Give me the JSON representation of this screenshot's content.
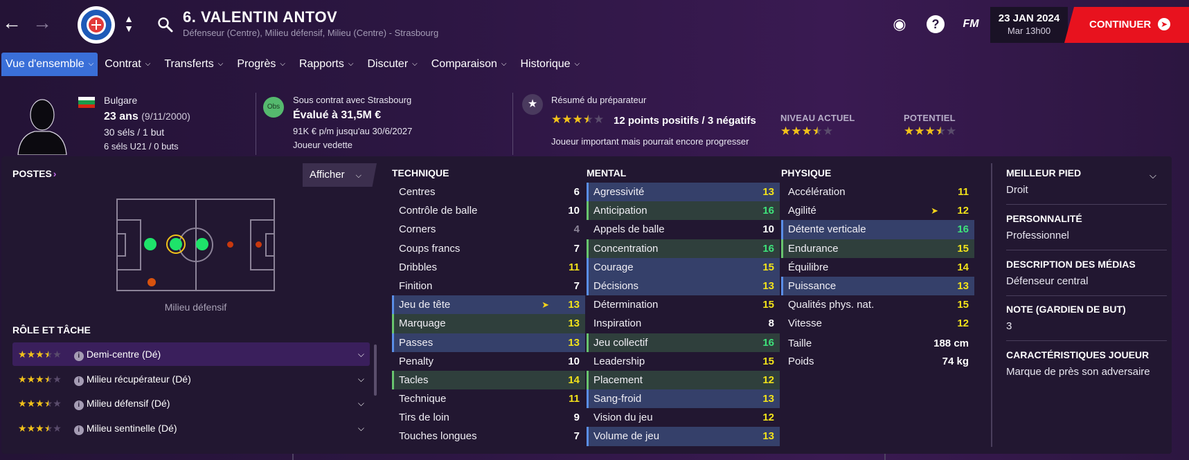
{
  "header": {
    "player_title": "6. VALENTIN ANTOV",
    "player_subtitle": "Défenseur (Centre), Milieu défensif, Milieu (Centre) - Strasbourg",
    "date": "23 JAN 2024",
    "time": "Mar 13h00",
    "continue_label": "CONTINUER",
    "fm_label": "FM",
    "help_label": "?"
  },
  "tabs": [
    {
      "label": "Vue d'ensemble"
    },
    {
      "label": "Contrat"
    },
    {
      "label": "Transferts"
    },
    {
      "label": "Progrès"
    },
    {
      "label": "Rapports"
    },
    {
      "label": "Discuter"
    },
    {
      "label": "Comparaison"
    },
    {
      "label": "Historique"
    }
  ],
  "profile": {
    "nationality": "Bulgare",
    "age": "23 ans",
    "birthdate": "(9/11/2000)",
    "caps": "30 séls / 1 but",
    "u21_caps": "6 séls U21 / 0 buts",
    "contract_status": "Sous contrat avec Strasbourg",
    "value": "Évalué à 31,5M €",
    "wage": "91K € p/m jusqu'au 30/6/2027",
    "squad_status": "Joueur vedette",
    "obs_label": "Obs",
    "coach_summary_title": "Résumé du préparateur",
    "coach_summary_points": "12 points positifs / 3 négatifs",
    "coach_summary_text": "Joueur important mais pourrait encore progresser",
    "coach_stars": 3.5,
    "current_level_label": "NIVEAU ACTUEL",
    "current_level_stars": 3.5,
    "potential_label": "POTENTIEL",
    "potential_stars": 3.5
  },
  "positions": {
    "title": "POSTES",
    "show_button": "Afficher",
    "pitch_caption": "Milieu défensif",
    "role_title": "RÔLE ET TÂCHE",
    "roles": [
      {
        "name": "Demi-centre (Dé)",
        "stars": 3.5
      },
      {
        "name": "Milieu récupérateur (Dé)",
        "stars": 3.5
      },
      {
        "name": "Milieu défensif (Dé)",
        "stars": 3.5
      },
      {
        "name": "Milieu sentinelle (Dé)",
        "stars": 3.5
      }
    ]
  },
  "technique": {
    "title": "TECHNIQUE",
    "rows": [
      {
        "name": "Centres",
        "value": "6",
        "color": "white"
      },
      {
        "name": "Contrôle de balle",
        "value": "10",
        "color": "white"
      },
      {
        "name": "Corners",
        "value": "4",
        "color": "grey"
      },
      {
        "name": "Coups francs",
        "value": "7",
        "color": "white"
      },
      {
        "name": "Dribbles",
        "value": "11",
        "color": "yellow"
      },
      {
        "name": "Finition",
        "value": "7",
        "color": "white"
      },
      {
        "name": "Jeu de tête",
        "value": "13",
        "color": "yellow",
        "hl": "blue",
        "trend": true
      },
      {
        "name": "Marquage",
        "value": "13",
        "color": "yellow",
        "hl": "green"
      },
      {
        "name": "Passes",
        "value": "13",
        "color": "yellow",
        "hl": "blue"
      },
      {
        "name": "Penalty",
        "value": "10",
        "color": "white"
      },
      {
        "name": "Tacles",
        "value": "14",
        "color": "yellow",
        "hl": "green"
      },
      {
        "name": "Technique",
        "value": "11",
        "color": "yellow"
      },
      {
        "name": "Tirs de loin",
        "value": "9",
        "color": "white"
      },
      {
        "name": "Touches longues",
        "value": "7",
        "color": "white"
      }
    ]
  },
  "mental": {
    "title": "MENTAL",
    "rows": [
      {
        "name": "Agressivité",
        "value": "13",
        "color": "yellow",
        "hl": "blue"
      },
      {
        "name": "Anticipation",
        "value": "16",
        "color": "green",
        "hl": "green"
      },
      {
        "name": "Appels de balle",
        "value": "10",
        "color": "white"
      },
      {
        "name": "Concentration",
        "value": "16",
        "color": "green",
        "hl": "green"
      },
      {
        "name": "Courage",
        "value": "15",
        "color": "yellow",
        "hl": "blue"
      },
      {
        "name": "Décisions",
        "value": "13",
        "color": "yellow",
        "hl": "blue"
      },
      {
        "name": "Détermination",
        "value": "15",
        "color": "yellow"
      },
      {
        "name": "Inspiration",
        "value": "8",
        "color": "white"
      },
      {
        "name": "Jeu collectif",
        "value": "16",
        "color": "green",
        "hl": "green"
      },
      {
        "name": "Leadership",
        "value": "15",
        "color": "yellow"
      },
      {
        "name": "Placement",
        "value": "12",
        "color": "yellow",
        "hl": "green"
      },
      {
        "name": "Sang-froid",
        "value": "13",
        "color": "yellow",
        "hl": "blue"
      },
      {
        "name": "Vision du jeu",
        "value": "12",
        "color": "yellow"
      },
      {
        "name": "Volume de jeu",
        "value": "13",
        "color": "yellow",
        "hl": "blue"
      }
    ]
  },
  "physique": {
    "title": "PHYSIQUE",
    "rows": [
      {
        "name": "Accélération",
        "value": "11",
        "color": "yellow"
      },
      {
        "name": "Agilité",
        "value": "12",
        "color": "yellow",
        "trend": true
      },
      {
        "name": "Détente verticale",
        "value": "16",
        "color": "green",
        "hl": "blue"
      },
      {
        "name": "Endurance",
        "value": "15",
        "color": "yellow",
        "hl": "green"
      },
      {
        "name": "Équilibre",
        "value": "14",
        "color": "yellow"
      },
      {
        "name": "Puissance",
        "value": "13",
        "color": "yellow",
        "hl": "blue"
      },
      {
        "name": "Qualités phys. nat.",
        "value": "15",
        "color": "yellow"
      },
      {
        "name": "Vitesse",
        "value": "12",
        "color": "yellow"
      }
    ],
    "height_label": "Taille",
    "height_value": "188 cm",
    "weight_label": "Poids",
    "weight_value": "74 kg"
  },
  "details": [
    {
      "label": "MEILLEUR PIED",
      "value": "Droit"
    },
    {
      "label": "PERSONNALITÉ",
      "value": "Professionnel"
    },
    {
      "label": "DESCRIPTION DES MÉDIAS",
      "value": "Défenseur central"
    },
    {
      "label": "NOTE (GARDIEN DE BUT)",
      "value": "3"
    },
    {
      "label": "CARACTÉRISTIQUES JOUEUR",
      "value": "Marque de près son adversaire"
    }
  ],
  "colors": {
    "accent_red": "#e8121e",
    "tab_active": "#3a6fd8",
    "star": "#f2c21a",
    "attr_green": "#3ee27a",
    "attr_yellow": "#f2e21a",
    "position_natural": "#1ee36a",
    "position_secondary": "#d8520e"
  },
  "icons": [
    "back-arrow-icon",
    "forward-arrow-icon",
    "club-crest-icon",
    "search-icon",
    "globe-icon",
    "help-icon",
    "chevron-down-icon",
    "star-icon",
    "info-icon",
    "trend-arrow-icon"
  ]
}
